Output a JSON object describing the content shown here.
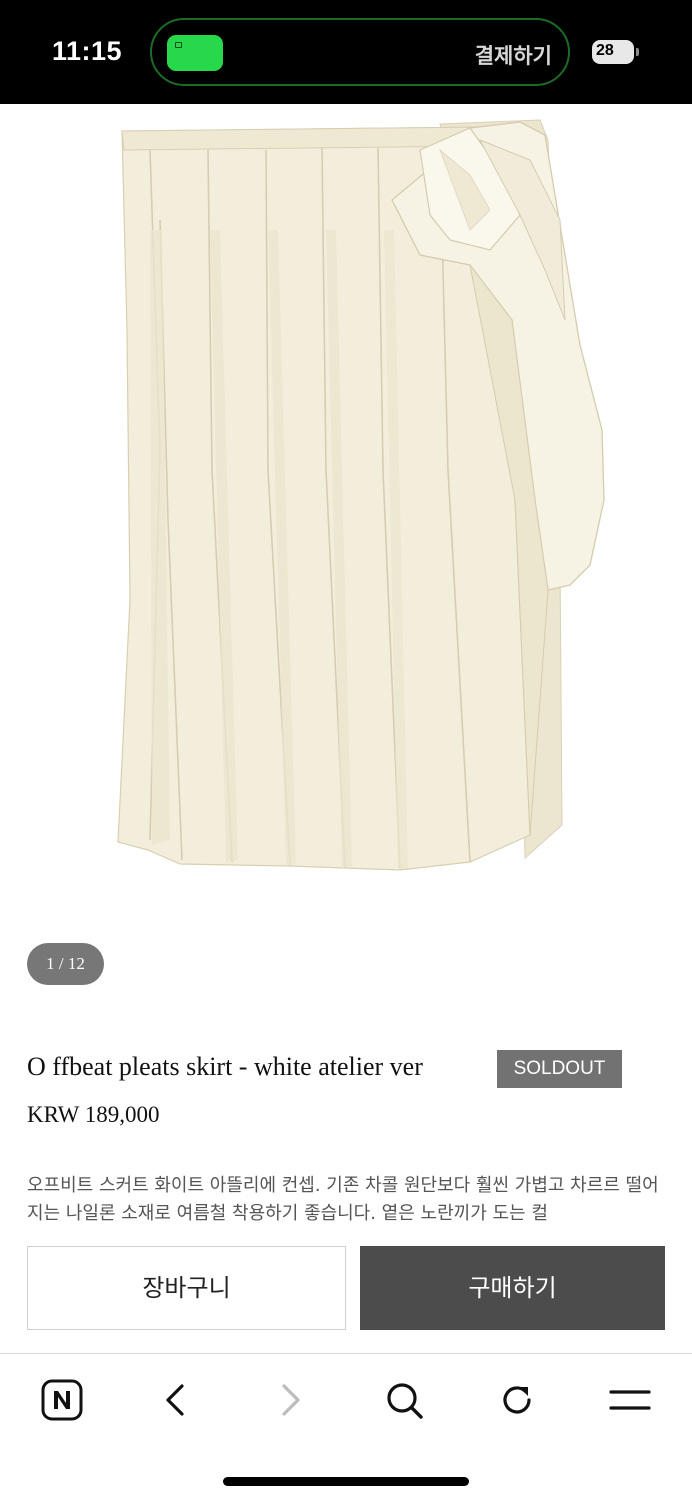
{
  "status_bar": {
    "time": "11:15",
    "island_text": "결제하기",
    "battery_level": "28"
  },
  "gallery": {
    "counter": "1 / 12"
  },
  "product": {
    "title": "O ffbeat pleats skirt - white atelier ver",
    "badge": "SOLDOUT",
    "price": "KRW 189,000",
    "description": "오프비트 스커트 화이트 아뜰리에 컨셉. 기존 차콜 원단보다 훨씬 가볍고 차르르 떨어지는 나일론 소재로 여름철 착용하기 좋습니다. 옅은 노란끼가 도는 컬"
  },
  "actions": {
    "cart_label": "장바구니",
    "buy_label": "구매하기"
  },
  "browser_toolbar": {
    "items": [
      "naver-home-icon",
      "back-icon",
      "forward-icon",
      "search-icon",
      "refresh-icon",
      "menu-icon"
    ]
  },
  "colors": {
    "island_app": "#27d84a",
    "soldout_badge": "#727272",
    "buy_button": "#4c4c4c",
    "skirt": "#f3eedc"
  }
}
